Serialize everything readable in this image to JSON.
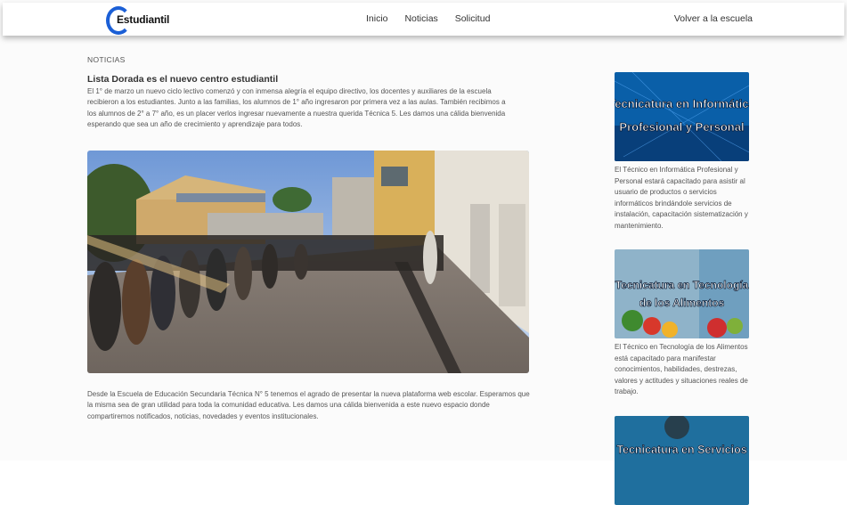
{
  "nav": {
    "logo_text": "Estudiantil",
    "links": [
      "Inicio",
      "Noticias",
      "Solicitud"
    ],
    "back_link": "Volver a la escuela"
  },
  "article": {
    "section_label": "NOTICIAS",
    "title": "Lista Dorada es el nuevo centro estudiantil",
    "body": "El 1° de marzo un nuevo ciclo lectivo comenzó y con inmensa alegría el equipo directivo, los docentes y auxiliares de la escuela recibieron a los estudiantes. Junto a las familias, los alumnos de 1° año ingresaron por primera vez a las aulas. También recibimos a los alumnos de 2° a 7° año, es un placer verlos ingresar nuevamente a nuestra querida Técnica 5. Les damos una cálida bienvenida esperando que sea un año de crecimiento y aprendizaje para todos.",
    "footer": "Desde la Escuela de Educación Secundaria Técnica N° 5 tenemos el agrado de presentar la nueva plataforma web escolar. Esperamos que la misma sea de gran utilidad para toda la comunidad educativa. Les damos una cálida bienvenida a este nuevo espacio donde compartiremos notificados, noticias, novedades y eventos institucionales."
  },
  "sidebar": {
    "cards": [
      {
        "image_title": "Tecnicatura en Informática Profesional y Personal",
        "image_line1": "Tecnicatura en Informática",
        "image_line2": "Profesional y Personal",
        "text": "El Técnico en Informática Profesional y Personal estará capacitado para asistir al usuario de productos o servicios informáticos brindándole servicios de instalación, capacitación sistematización y mantenimiento."
      },
      {
        "image_line1": "Tecnicatura en Tecnología",
        "image_line2": "de los Alimentos",
        "text": "El Técnico en Tecnología de los Alimentos está capacitado para manifestar conocimientos, habilidades, destrezas, valores y actitudes y situaciones reales de trabajo."
      },
      {
        "image_line1": "Tecnicatura en Servicios",
        "image_line2": ""
      }
    ]
  },
  "colors": {
    "accent_blue": "#1b5fd6",
    "card1_bg": "#0a5fa8",
    "card2_bg": "#8fb3c9",
    "card3_bg": "#1f6f9e"
  }
}
